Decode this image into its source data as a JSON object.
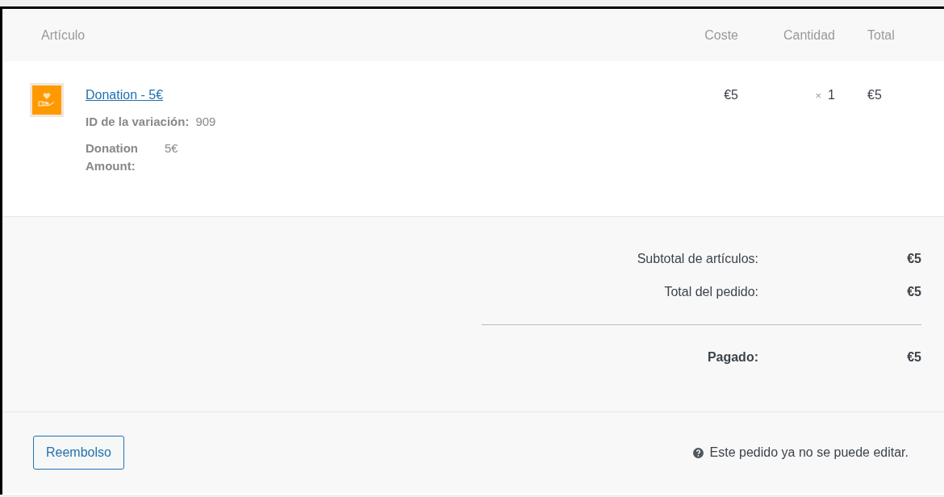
{
  "columns": [
    "Artículo",
    "Coste",
    "Cantidad",
    "Total"
  ],
  "items": [
    {
      "name": "Donation - 5€",
      "meta": [
        {
          "kind": "line",
          "key": "ID de la variación:",
          "value": "909"
        },
        {
          "kind": "table",
          "key": "Donation Amount:",
          "value": "5€"
        }
      ],
      "cost": "€5",
      "qty_sign": "×",
      "qty": "1",
      "total": "€5"
    }
  ],
  "totals": [
    {
      "label": "Subtotal de artículos:",
      "value": "€5"
    },
    {
      "label": "Total del pedido:",
      "value": "€5"
    }
  ],
  "paid": {
    "label": "Pagado:",
    "value": "€5"
  },
  "refund_button": "Reembolso",
  "notice": "Este pedido ya no se puede editar."
}
